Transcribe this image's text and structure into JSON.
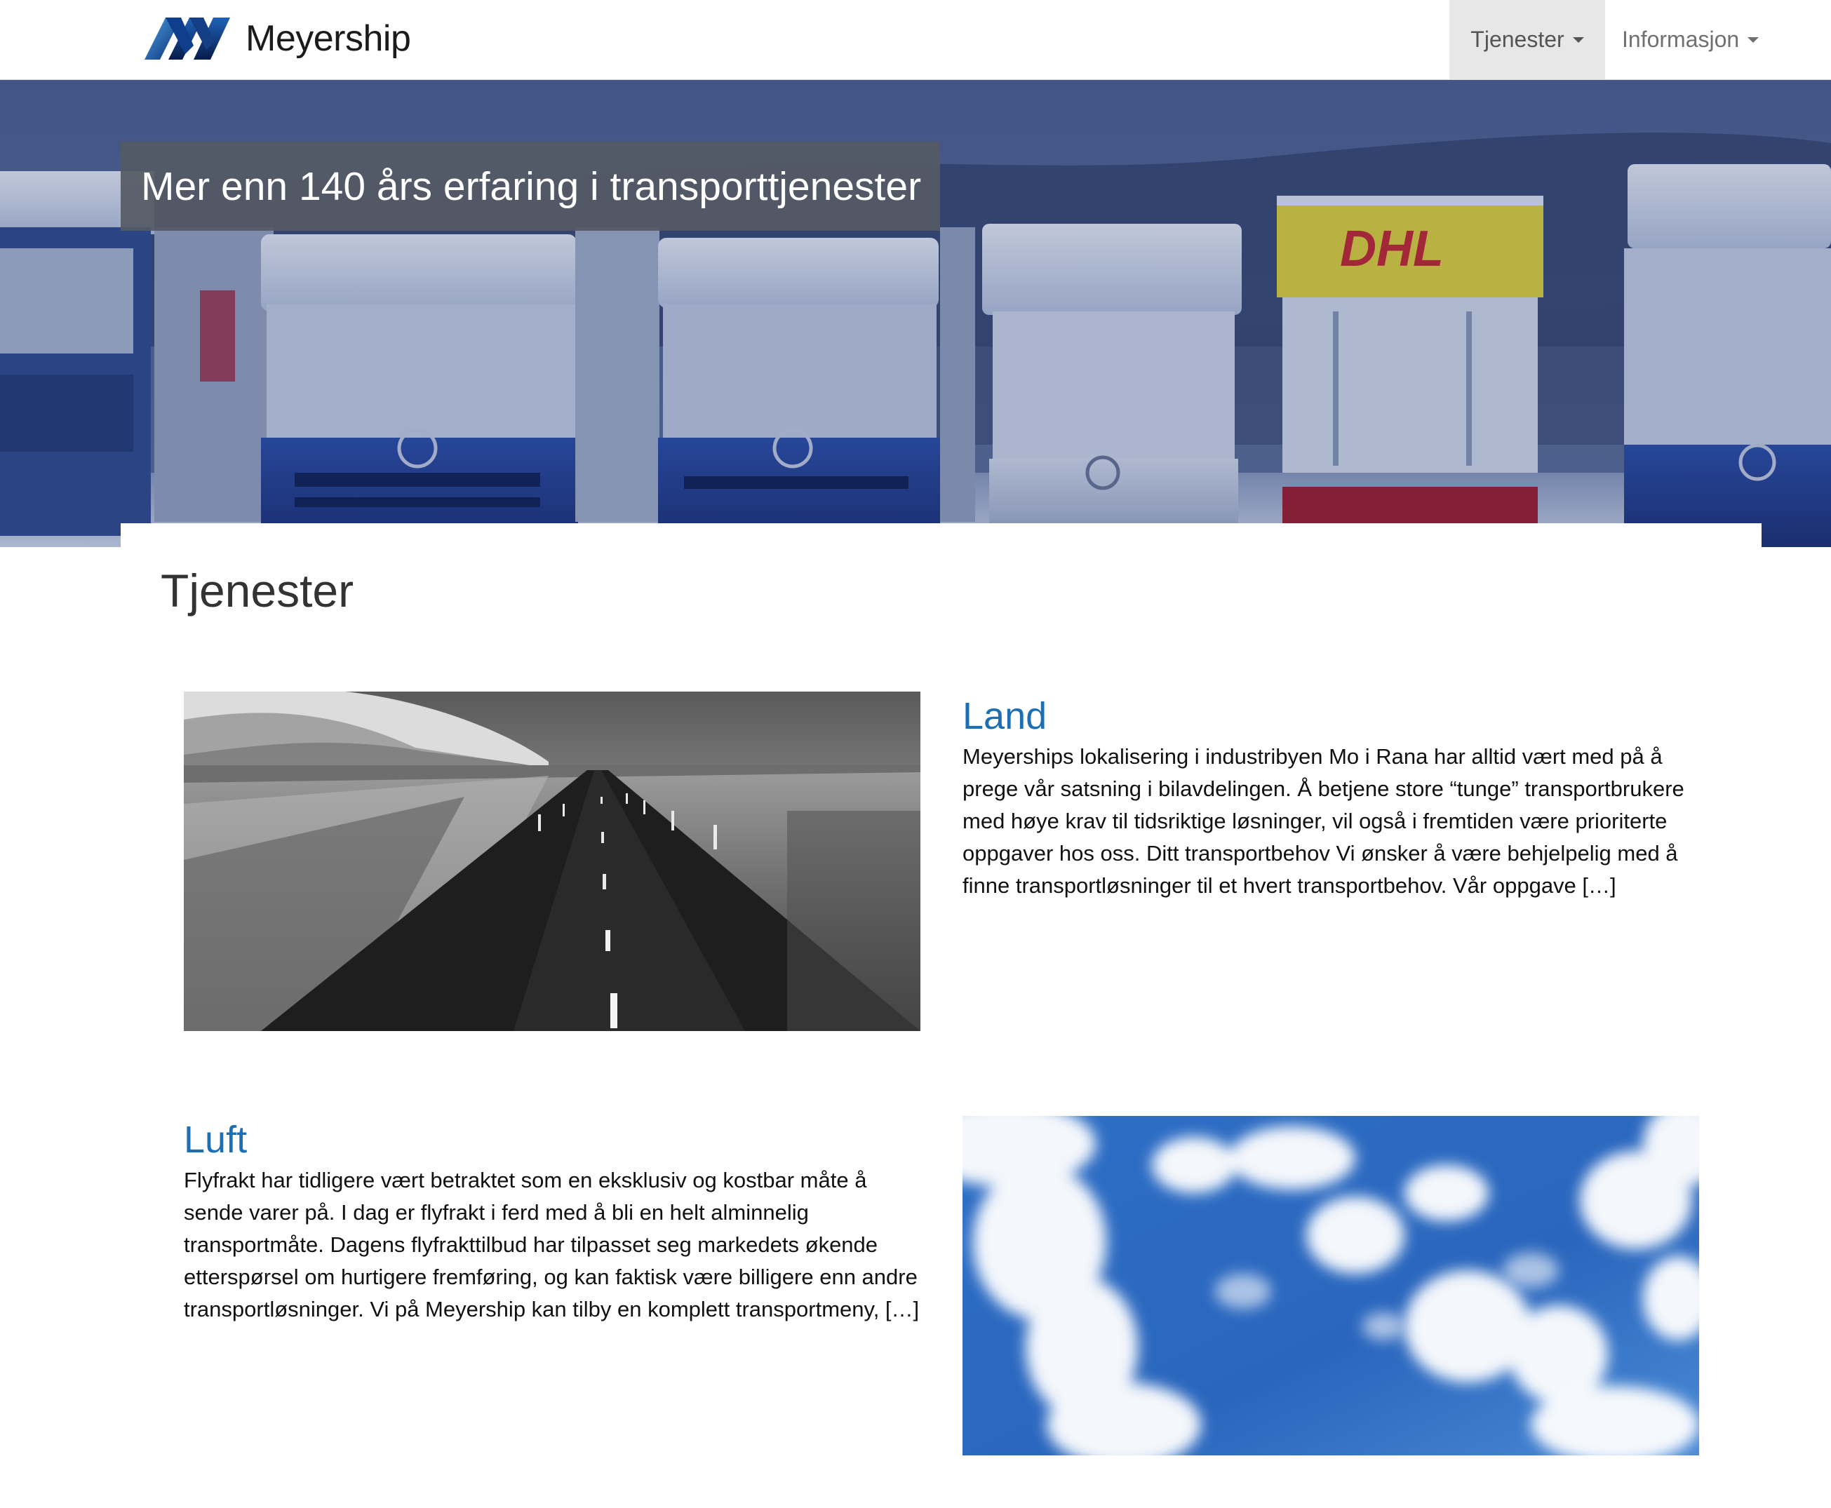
{
  "brand": {
    "name": "Meyership",
    "logo_icon": "meyership-m-logo-icon"
  },
  "nav": {
    "items": [
      {
        "label": "Tjenester",
        "active": true
      },
      {
        "label": "Informasjon",
        "active": false
      }
    ]
  },
  "hero": {
    "title": "Mer enn 140 års erfaring i transporttjenester"
  },
  "section": {
    "title": "Tjenester"
  },
  "services": [
    {
      "title": "Land",
      "text": "Meyerships lokalisering i industribyen Mo i Rana har alltid vært med på å prege vår satsning i bilavdelingen. Å betjene store “tunge” transportbrukere med høye krav til tidsriktige løsninger, vil også i fremtiden være prioriterte oppgaver hos oss. Ditt transportbehov Vi ønsker å være behjelpelig med å finne transportløsninger til et hvert transportbehov. Vår oppgave […]"
    },
    {
      "title": "Luft",
      "text": "Flyfrakt har tidligere vært betraktet som en eksklusiv og kostbar måte å sende varer på. I dag er flyfrakt i ferd med å bli en helt alminnelig transportmåte. Dagens flyfrakttilbud har tilpasset seg markedets økende etterspørsel om hurtigere fremføring, og kan faktisk være billigere enn andre transportløsninger. Vi på Meyership kan tilby en komplett transportmeny, […]"
    }
  ],
  "colors": {
    "link": "#1d6fb4",
    "nav_active_bg": "#e7e7e7",
    "hero_title_bg": "#555a64"
  }
}
